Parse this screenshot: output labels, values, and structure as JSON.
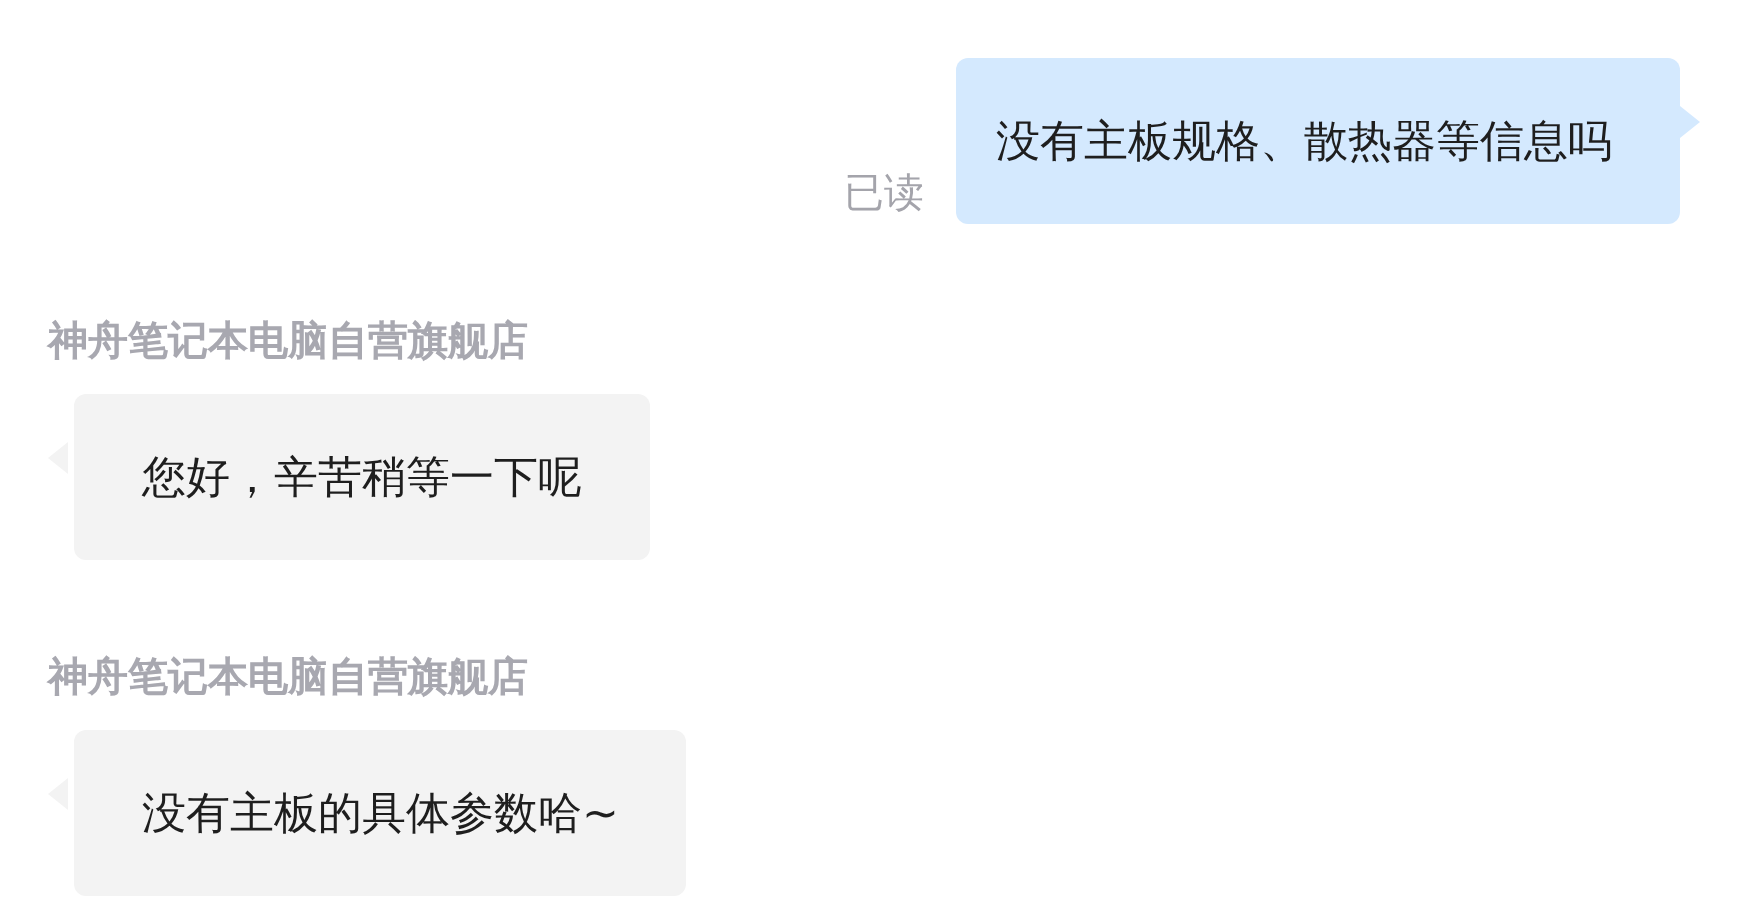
{
  "messages": [
    {
      "kind": "outgoing",
      "text": "没有主板规格、散热器等信息吗",
      "status": "已读"
    },
    {
      "kind": "incoming",
      "sender": "神舟笔记本电脑自营旗舰店",
      "text": "您好，辛苦稍等一下呢"
    },
    {
      "kind": "incoming",
      "sender": "神舟笔记本电脑自营旗舰店",
      "text": "没有主板的具体参数哈~"
    }
  ]
}
